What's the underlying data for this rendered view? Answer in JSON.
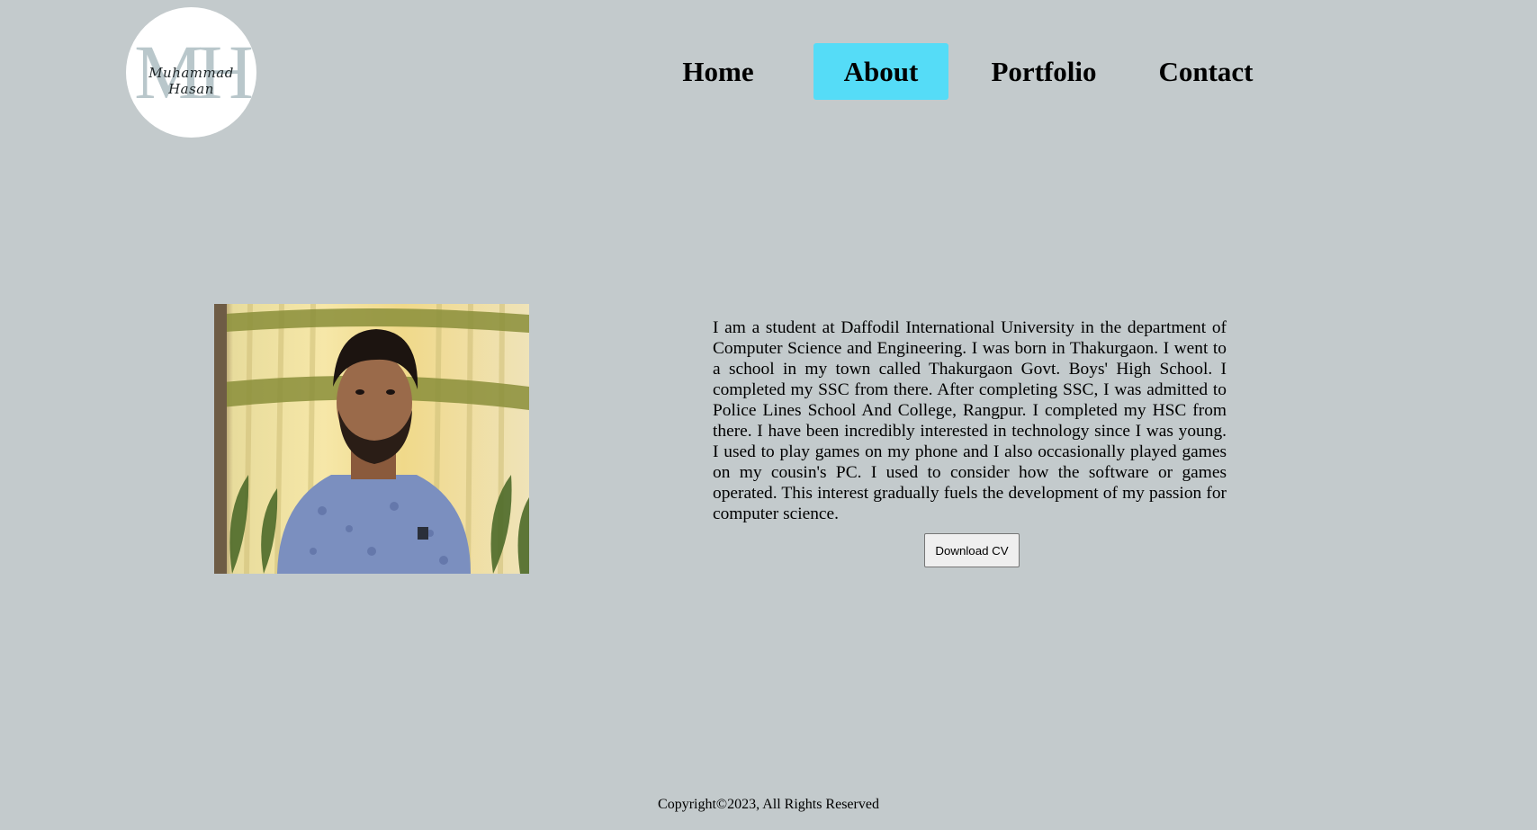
{
  "logo": {
    "monogram": "MH",
    "signature": "Muhammad Hasan"
  },
  "nav": {
    "items": [
      {
        "label": "Home",
        "active": false
      },
      {
        "label": "About",
        "active": true
      },
      {
        "label": "Portfolio",
        "active": false
      },
      {
        "label": "Contact",
        "active": false
      }
    ]
  },
  "colors": {
    "page_background": "#c3cacc",
    "active_nav": "#55dcf7"
  },
  "about": {
    "bio": "I am a student at Daffodil International University in the department of Computer Science and Engineering. I was born in Thakurgaon. I went to a school in my town called Thakurgaon Govt. Boys' High School. I completed my SSC from there. After completing SSC, I was admitted to Police Lines School And College, Rangpur. I completed my HSC from there. I have been incredibly interested in technology since I was young. I used to play games on my phone and I also occasionally played games on my cousin's PC. I used to consider how the software or games operated. This interest gradually fuels the development of my passion for computer science.",
    "download_label": "Download CV"
  },
  "footer": {
    "copyright": "Copyright©2023, All Rights Reserved"
  }
}
